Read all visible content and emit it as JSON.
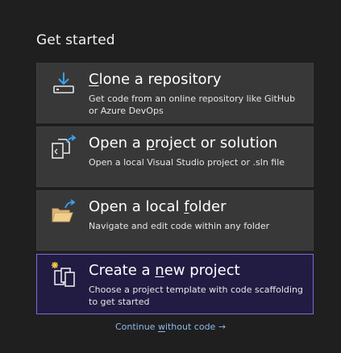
{
  "heading": "Get started",
  "cards": [
    {
      "title_pre": "",
      "title_key": "C",
      "title_post": "lone a repository",
      "description": "Get code from an online repository like GitHub or Azure DevOps",
      "icon": "clone-download-icon"
    },
    {
      "title_pre": "Open a ",
      "title_key": "p",
      "title_post": "roject or solution",
      "description": "Open a local Visual Studio project or .sln file",
      "icon": "open-project-icon"
    },
    {
      "title_pre": "Open a local ",
      "title_key": "f",
      "title_post": "older",
      "description": "Navigate and edit code within any folder",
      "icon": "open-folder-icon"
    },
    {
      "title_pre": "Create a ",
      "title_key": "n",
      "title_post": "ew project",
      "description": "Choose a project template with code scaffolding to get started",
      "icon": "new-project-icon"
    }
  ],
  "continue": {
    "pre": "Continue ",
    "key": "w",
    "post": "ithout code →"
  },
  "colors": {
    "background": "#1f1f1f",
    "card": "#383838",
    "selected_card": "#221c43",
    "selected_border": "#7a6cd6",
    "link": "#8fb8e8",
    "icon_accent": "#3aa0f3"
  }
}
